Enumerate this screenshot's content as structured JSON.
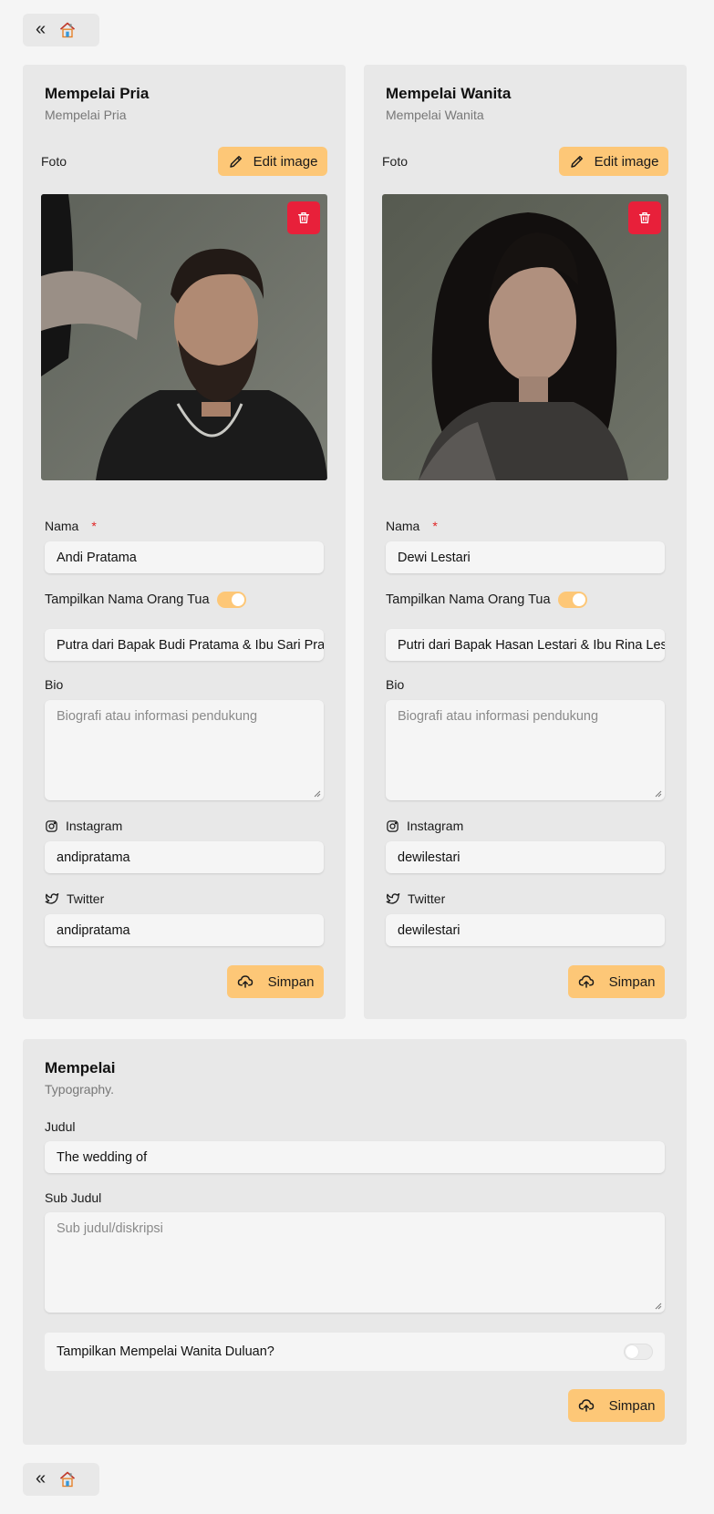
{
  "nav": {
    "back_glyph": "«",
    "home_icon": "home-icon"
  },
  "groom": {
    "title": "Mempelai Pria",
    "subtitle": "Mempelai Pria",
    "foto_label": "Foto",
    "edit_image_label": "Edit image",
    "name_label": "Nama",
    "required_mark": "*",
    "name_value": "Andi Pratama",
    "show_parents_label": "Tampilkan Nama Orang Tua",
    "show_parents_on": true,
    "parents_value": "Putra dari Bapak Budi Pratama & Ibu Sari Pratama",
    "bio_label": "Bio",
    "bio_placeholder": "Biografi atau informasi pendukung",
    "instagram_label": "Instagram",
    "instagram_value": "andipratama",
    "twitter_label": "Twitter",
    "twitter_value": "andipratama",
    "save_label": "Simpan"
  },
  "bride": {
    "title": "Mempelai Wanita",
    "subtitle": "Mempelai Wanita",
    "foto_label": "Foto",
    "edit_image_label": "Edit image",
    "name_label": "Nama",
    "required_mark": "*",
    "name_value": "Dewi Lestari",
    "show_parents_label": "Tampilkan Nama Orang Tua",
    "show_parents_on": true,
    "parents_value": "Putri dari Bapak Hasan Lestari & Ibu Rina Lestari",
    "bio_label": "Bio",
    "bio_placeholder": "Biografi atau informasi pendukung",
    "instagram_label": "Instagram",
    "instagram_value": "dewilestari",
    "twitter_label": "Twitter",
    "twitter_value": "dewilestari",
    "save_label": "Simpan"
  },
  "mempelai": {
    "title": "Mempelai",
    "subtitle": "Typography.",
    "judul_label": "Judul",
    "judul_value": "The wedding of",
    "subjudul_label": "Sub Judul",
    "subjudul_placeholder": "Sub judul/diskripsi",
    "bride_first_label": "Tampilkan Mempelai Wanita Duluan?",
    "bride_first_on": false,
    "save_label": "Simpan"
  },
  "colors": {
    "accent": "#fdc777",
    "danger": "#e8203a",
    "card_bg": "#e8e8e8",
    "page_bg": "#f5f5f5"
  }
}
